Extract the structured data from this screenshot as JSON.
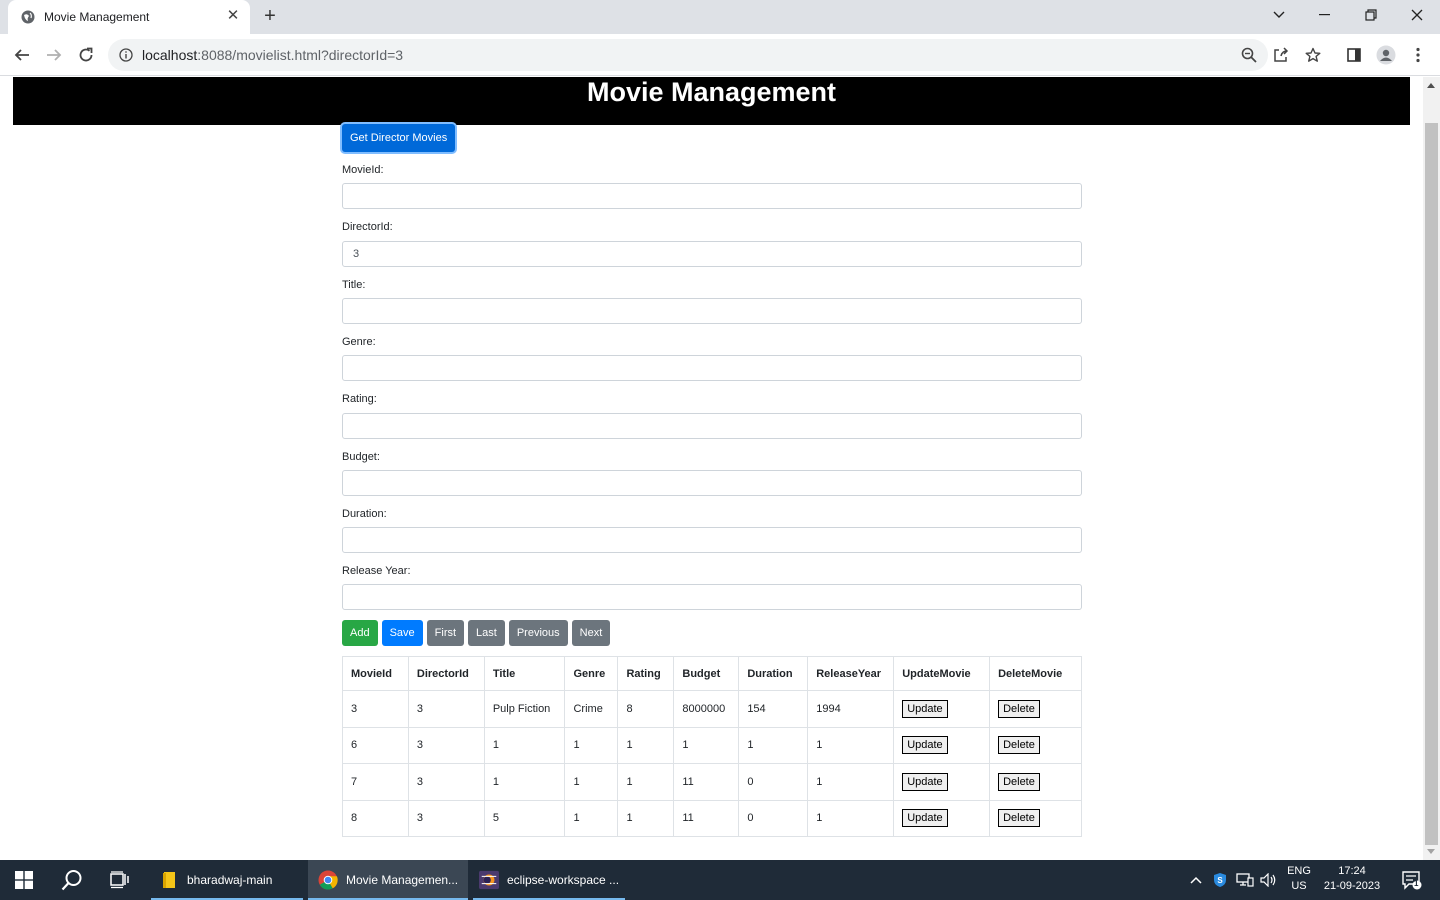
{
  "browser": {
    "tab_title": "Movie Management",
    "url_host": "localhost",
    "url_rest": ":8088/movielist.html?directorId=3"
  },
  "page": {
    "heading": "Movie Management",
    "get_director_movies_label": "Get Director Movies"
  },
  "form": {
    "fields": [
      {
        "label": "MovieId:",
        "value": ""
      },
      {
        "label": "DirectorId:",
        "value": "3"
      },
      {
        "label": "Title:",
        "value": ""
      },
      {
        "label": "Genre:",
        "value": ""
      },
      {
        "label": "Rating:",
        "value": ""
      },
      {
        "label": "Budget:",
        "value": ""
      },
      {
        "label": "Duration:",
        "value": ""
      },
      {
        "label": "Release Year:",
        "value": ""
      }
    ]
  },
  "actions": {
    "add": "Add",
    "save": "Save",
    "first": "First",
    "last": "Last",
    "previous": "Previous",
    "next": "Next"
  },
  "table": {
    "headers": [
      "MovieId",
      "DirectorId",
      "Title",
      "Genre",
      "Rating",
      "Budget",
      "Duration",
      "ReleaseYear",
      "UpdateMovie",
      "DeleteMovie"
    ],
    "update_label": "Update",
    "delete_label": "Delete",
    "rows": [
      [
        "3",
        "3",
        "Pulp Fiction",
        "Crime",
        "8",
        "8000000",
        "154",
        "1994"
      ],
      [
        "6",
        "3",
        "1",
        "1",
        "1",
        "1",
        "1",
        "1"
      ],
      [
        "7",
        "3",
        "1",
        "1",
        "1",
        "11",
        "0",
        "1"
      ],
      [
        "8",
        "3",
        "5",
        "1",
        "1",
        "11",
        "0",
        "1"
      ]
    ]
  },
  "taskbar": {
    "apps": [
      {
        "label": "bharadwaj-main",
        "icon": "folder-icon"
      },
      {
        "label": "Movie Managemen...",
        "icon": "chrome-icon"
      },
      {
        "label": "eclipse-workspace ...",
        "icon": "eclipse-icon"
      }
    ],
    "lang_top": "ENG",
    "lang_bottom": "US",
    "time": "17:24",
    "date": "21-09-2023",
    "notification_count": "1"
  },
  "colors": {
    "primary": "#007bff",
    "success": "#28a745",
    "secondary": "#6c757d",
    "header_bg": "#000000"
  }
}
